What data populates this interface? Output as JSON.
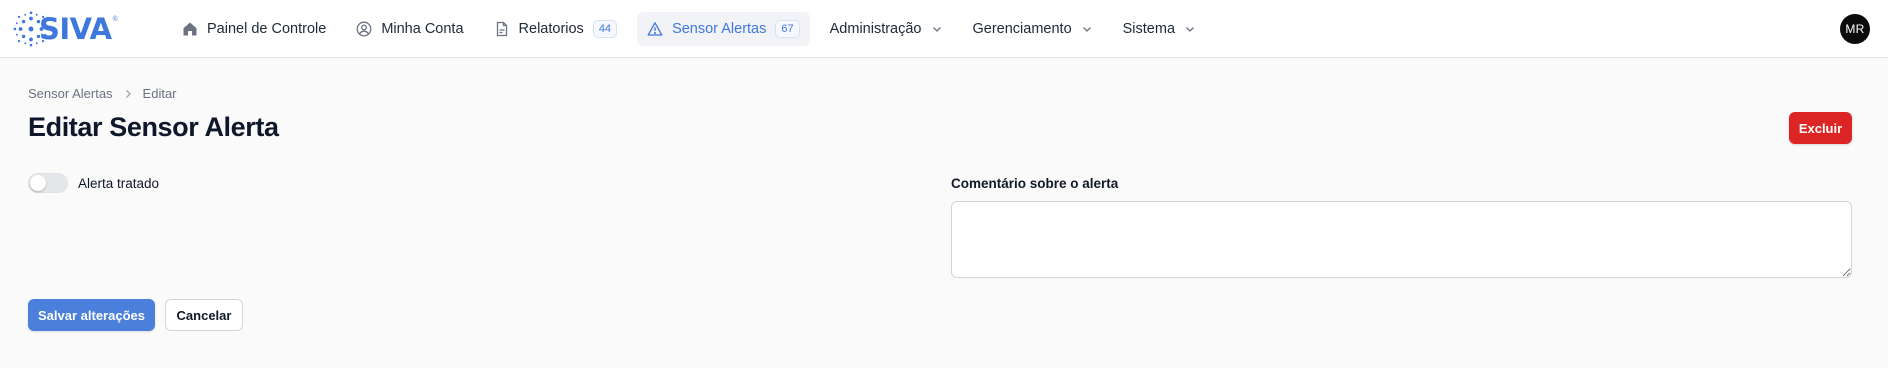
{
  "app": {
    "logo_text": "SIVA",
    "logo_mark": "®",
    "brand_color": "#3f78dd"
  },
  "nav": {
    "items": [
      {
        "label": "Painel de Controle",
        "icon": "home-icon"
      },
      {
        "label": "Minha Conta",
        "icon": "user-circle-icon"
      },
      {
        "label": "Relatorios",
        "icon": "document-icon",
        "badge": "44"
      },
      {
        "label": "Sensor Alertas",
        "icon": "warning-triangle-icon",
        "badge": "67",
        "active": true
      },
      {
        "label": "Administração",
        "dropdown": true
      },
      {
        "label": "Gerenciamento",
        "dropdown": true
      },
      {
        "label": "Sistema",
        "dropdown": true
      }
    ]
  },
  "user": {
    "initials": "MR"
  },
  "breadcrumb": {
    "parent": "Sensor Alertas",
    "current": "Editar"
  },
  "page": {
    "title": "Editar Sensor Alerta"
  },
  "actions": {
    "delete_label": "Excluir",
    "save_label": "Salvar alterações",
    "cancel_label": "Cancelar"
  },
  "form": {
    "handled_toggle": {
      "label": "Alerta tratado",
      "checked": false
    },
    "comment": {
      "label": "Comentário sobre o alerta",
      "value": "",
      "placeholder": ""
    }
  },
  "colors": {
    "primary": "#4a7fdb",
    "danger": "#dc2626",
    "active_nav_bg": "#f1f3f6"
  }
}
